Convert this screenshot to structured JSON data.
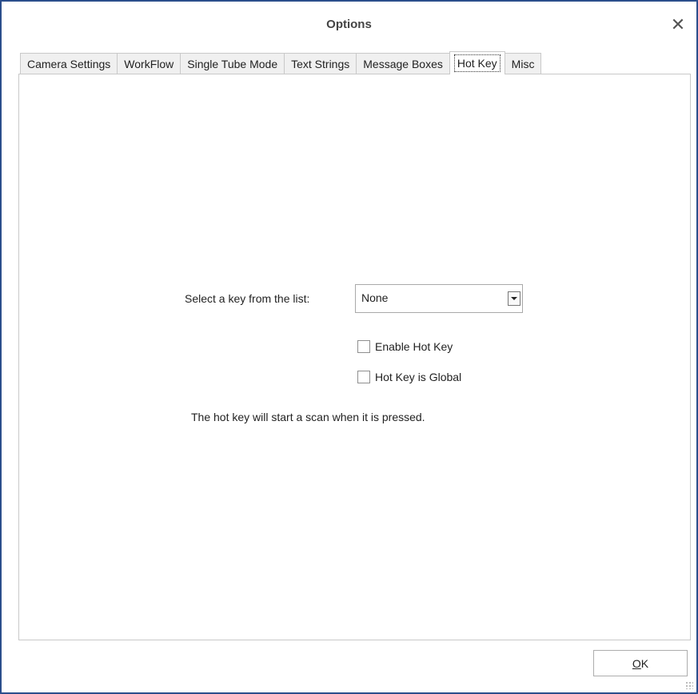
{
  "window": {
    "title": "Options",
    "close_symbol": "✕"
  },
  "tabs": [
    {
      "label": "Camera Settings"
    },
    {
      "label": "WorkFlow"
    },
    {
      "label": "Single Tube Mode"
    },
    {
      "label": "Text Strings"
    },
    {
      "label": "Message Boxes"
    },
    {
      "label": "Hot Key",
      "active": true
    },
    {
      "label": "Misc"
    }
  ],
  "hotkey": {
    "select_label": "Select a key from the list:",
    "selected_key": "None",
    "enable_label": "Enable Hot Key",
    "enable_checked": false,
    "global_label": "Hot Key is Global",
    "global_checked": false,
    "note": "The hot key will start a scan when it is pressed."
  },
  "footer": {
    "ok_mnemonic": "O",
    "ok_rest": "K"
  },
  "colors": {
    "window_border": "#2b4e8c",
    "tab_inactive_bg": "#f0f0f0",
    "panel_border": "#c9c9c9"
  }
}
